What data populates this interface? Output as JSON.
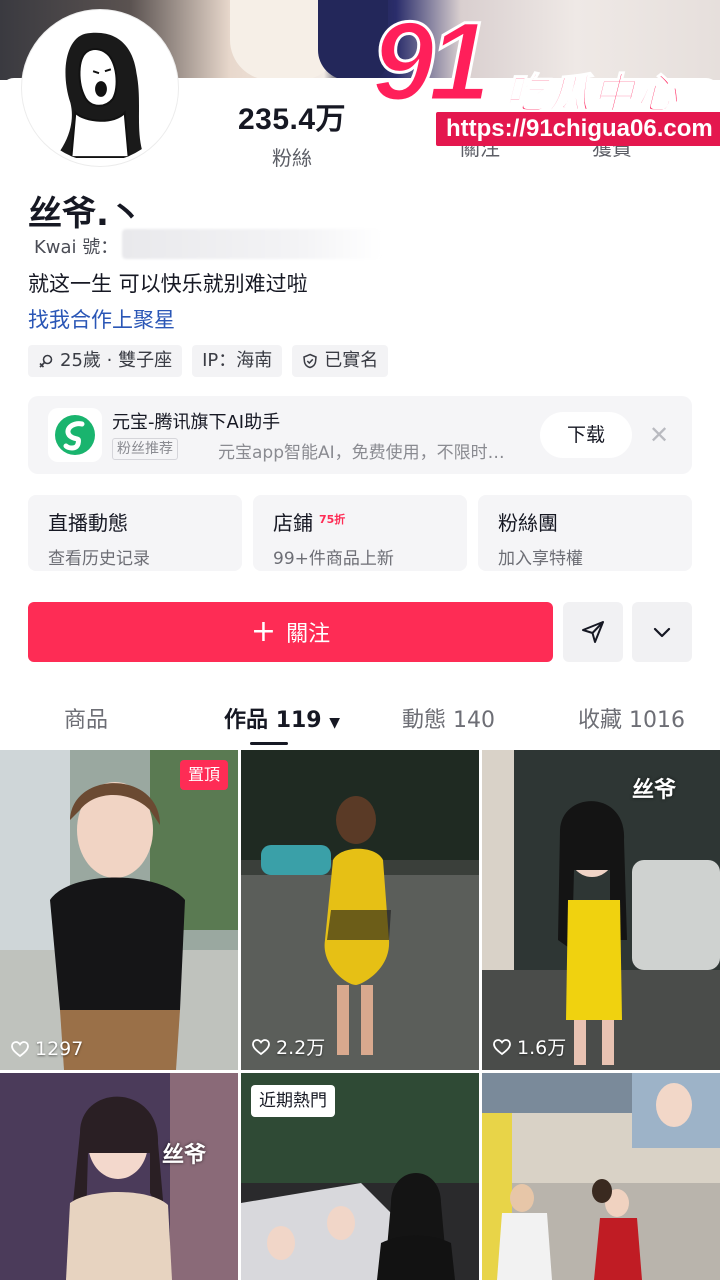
{
  "profile": {
    "followers_count": "235.4万",
    "followers_label": "粉絲",
    "following_label": "關注",
    "likes_label": "獲贊",
    "name": "丝爷.丶",
    "kwai_label": "Kwai 號：",
    "bio": "就这一生 可以快乐就别难过啦",
    "bio_link": "找我合作上聚星",
    "tags": [
      {
        "icon": "gender-icon",
        "text": "25歲 · 雙子座"
      },
      {
        "icon": "",
        "text": "IP：海南"
      },
      {
        "icon": "shield-check-icon",
        "text": "已實名"
      }
    ]
  },
  "watermark": {
    "number": "91",
    "text": "吃瓜中心",
    "url": "https://91chigua06.com"
  },
  "promo": {
    "title": "元宝-腾讯旗下AI助手",
    "badge": "粉丝推荐",
    "description": "元宝app智能AI，免费使用，不限时…",
    "download_label": "下载",
    "close_icon": "close-icon"
  },
  "features": [
    {
      "title": "直播動態",
      "subtitle": "查看历史记录",
      "sale": ""
    },
    {
      "title": "店鋪",
      "subtitle": "99+件商品上新",
      "sale": "75折"
    },
    {
      "title": "粉絲團",
      "subtitle": "加入享特權",
      "sale": ""
    }
  ],
  "actions": {
    "follow_label": "關注",
    "follow_icon": "plus-icon",
    "message_icon": "send-icon",
    "more_icon": "chevron-down-icon"
  },
  "tabs": [
    {
      "label": "商品",
      "count": "",
      "active": false
    },
    {
      "label": "作品",
      "count": "119",
      "active": true
    },
    {
      "label": "動態",
      "count": "140",
      "active": false
    },
    {
      "label": "收藏",
      "count": "1016",
      "active": false
    }
  ],
  "videos": [
    {
      "likes": "1297",
      "pinned_label": "置頂"
    },
    {
      "likes": "2.2万"
    },
    {
      "likes": "1.6万",
      "watermark": "丝爷"
    },
    {
      "watermark": "丝爷"
    },
    {
      "hot_label": "近期熱門"
    },
    {}
  ],
  "colors": {
    "accent": "#fe2c55",
    "link": "#2a56b6",
    "watermark_red": "#ff1f5a"
  }
}
